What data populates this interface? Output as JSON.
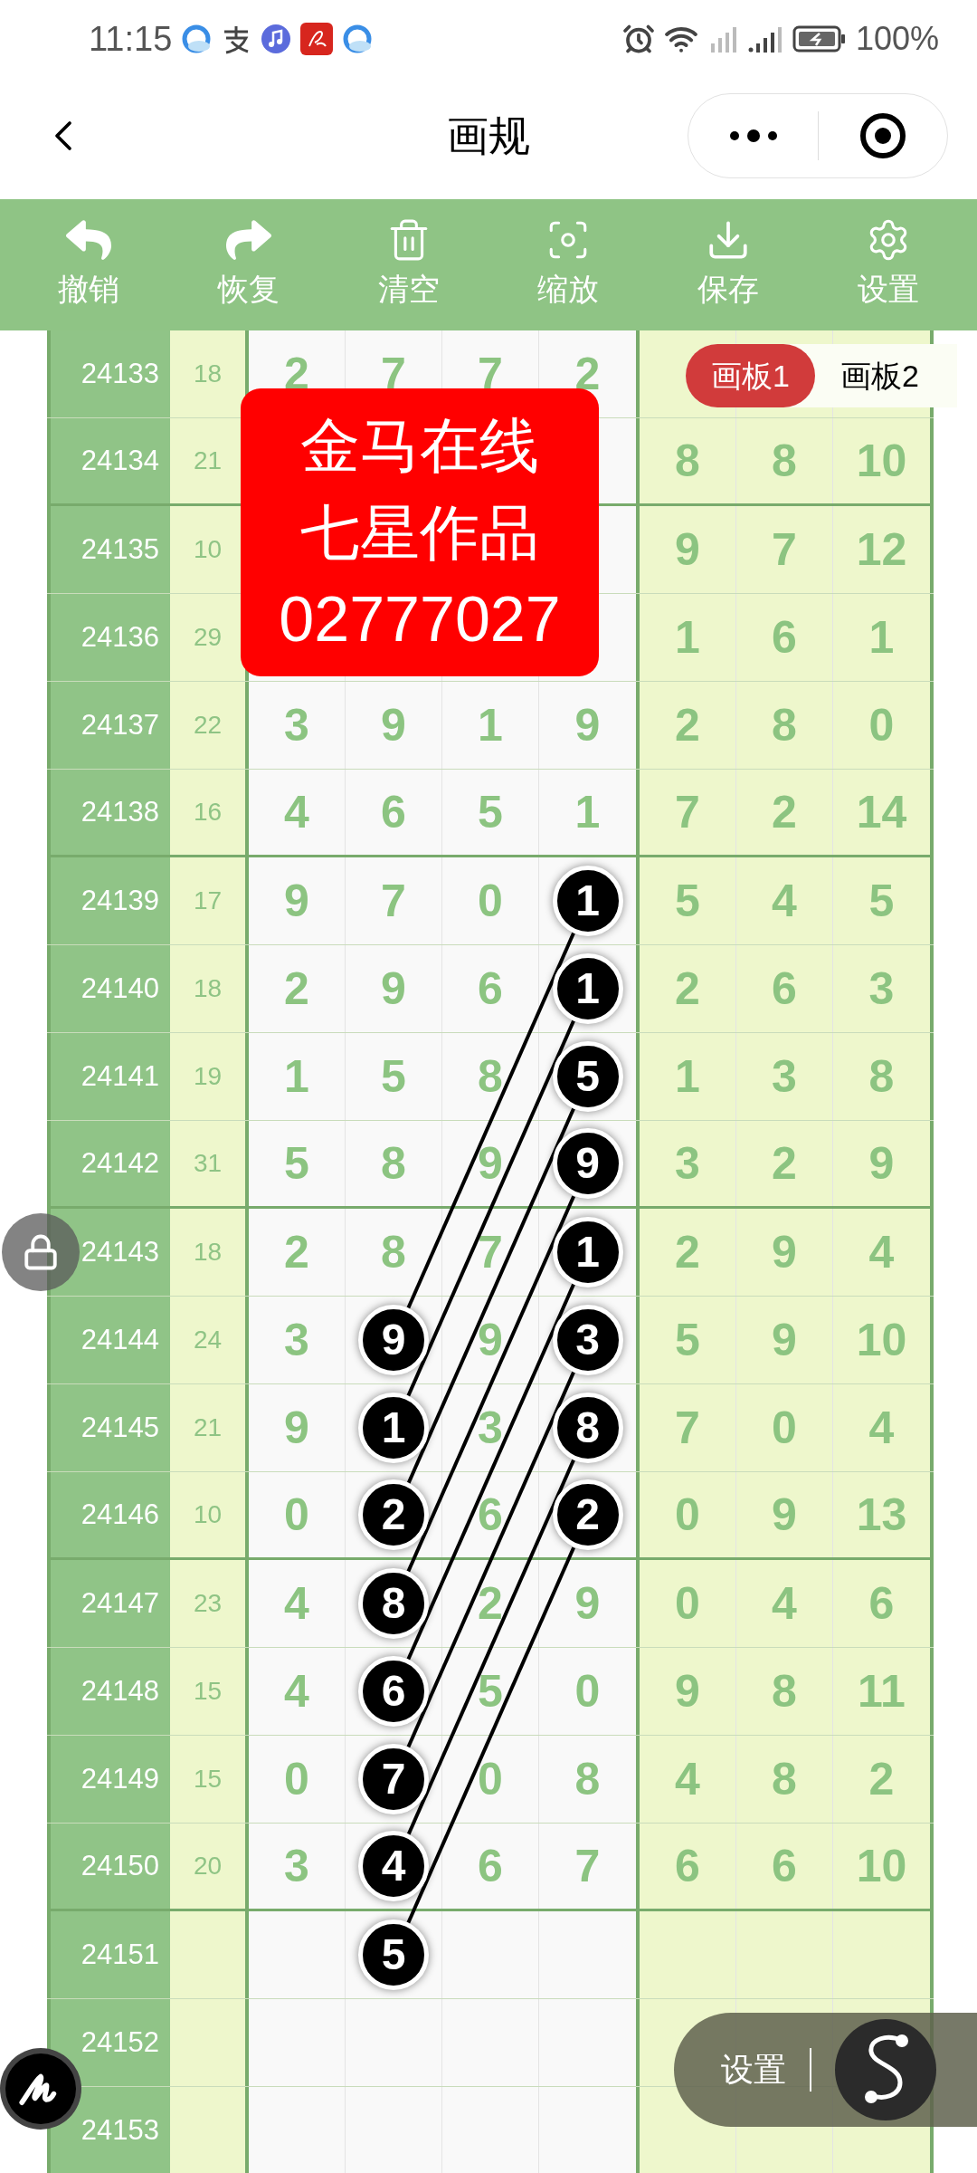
{
  "status_bar": {
    "time": "11:15",
    "battery": "100%"
  },
  "nav": {
    "title": "画规"
  },
  "toolbar": [
    {
      "kind": "undo",
      "label": "撤销"
    },
    {
      "kind": "redo",
      "label": "恢复"
    },
    {
      "kind": "clear",
      "label": "清空"
    },
    {
      "kind": "zoom",
      "label": "缩放"
    },
    {
      "kind": "save",
      "label": "保存"
    },
    {
      "kind": "settings",
      "label": "设置"
    }
  ],
  "board_tabs": [
    {
      "label": "画板1",
      "selected": true
    },
    {
      "label": "画板2",
      "selected": false
    }
  ],
  "banner": {
    "lines": [
      "金马在线",
      "七星作品",
      "02777027"
    ]
  },
  "rows": [
    {
      "issue": "24133",
      "sum": "18",
      "cells": [
        "2",
        "7",
        "7",
        "2",
        null,
        null,
        null
      ]
    },
    {
      "issue": "24134",
      "sum": "21",
      "cells": [
        null,
        null,
        null,
        null,
        "8",
        "8",
        "10"
      ]
    },
    {
      "issue": "24135",
      "sum": "10",
      "cells": [
        null,
        null,
        null,
        null,
        "9",
        "7",
        "12"
      ]
    },
    {
      "issue": "24136",
      "sum": "29",
      "cells": [
        null,
        null,
        null,
        null,
        "1",
        "6",
        "1"
      ]
    },
    {
      "issue": "24137",
      "sum": "22",
      "cells": [
        "3",
        "9",
        "1",
        "9",
        "2",
        "8",
        "0"
      ]
    },
    {
      "issue": "24138",
      "sum": "16",
      "cells": [
        "4",
        "6",
        "5",
        "1",
        "7",
        "2",
        "14"
      ]
    },
    {
      "issue": "24139",
      "sum": "17",
      "cells": [
        "9",
        "7",
        "0",
        {
          "value": "1",
          "circled": true
        },
        "5",
        "4",
        "5"
      ]
    },
    {
      "issue": "24140",
      "sum": "18",
      "cells": [
        "2",
        "9",
        "6",
        {
          "value": "1",
          "circled": true
        },
        "2",
        "6",
        "3"
      ]
    },
    {
      "issue": "24141",
      "sum": "19",
      "cells": [
        "1",
        "5",
        "8",
        {
          "value": "5",
          "circled": true
        },
        "1",
        "3",
        "8"
      ]
    },
    {
      "issue": "24142",
      "sum": "31",
      "cells": [
        "5",
        "8",
        "9",
        {
          "value": "9",
          "circled": true
        },
        "3",
        "2",
        "9"
      ]
    },
    {
      "issue": "24143",
      "sum": "18",
      "cells": [
        "2",
        "8",
        "7",
        {
          "value": "1",
          "circled": true
        },
        "2",
        "9",
        "4"
      ]
    },
    {
      "issue": "24144",
      "sum": "24",
      "cells": [
        "3",
        {
          "value": "9",
          "circled": true
        },
        "9",
        {
          "value": "3",
          "circled": true
        },
        "5",
        "9",
        "10"
      ]
    },
    {
      "issue": "24145",
      "sum": "21",
      "cells": [
        "9",
        {
          "value": "1",
          "circled": true
        },
        "3",
        {
          "value": "8",
          "circled": true
        },
        "7",
        "0",
        "4"
      ]
    },
    {
      "issue": "24146",
      "sum": "10",
      "cells": [
        "0",
        {
          "value": "2",
          "circled": true
        },
        "6",
        {
          "value": "2",
          "circled": true
        },
        "0",
        "9",
        "13"
      ]
    },
    {
      "issue": "24147",
      "sum": "23",
      "cells": [
        "4",
        {
          "value": "8",
          "circled": true
        },
        "2",
        "9",
        "0",
        "4",
        "6"
      ]
    },
    {
      "issue": "24148",
      "sum": "15",
      "cells": [
        "4",
        {
          "value": "6",
          "circled": true
        },
        "5",
        "0",
        "9",
        "8",
        "11"
      ]
    },
    {
      "issue": "24149",
      "sum": "15",
      "cells": [
        "0",
        {
          "value": "7",
          "circled": true
        },
        "0",
        "8",
        "4",
        "8",
        "2"
      ]
    },
    {
      "issue": "24150",
      "sum": "20",
      "cells": [
        "3",
        {
          "value": "4",
          "circled": true
        },
        "6",
        "7",
        "6",
        "6",
        "10"
      ]
    },
    {
      "issue": "24151",
      "sum": null,
      "cells": [
        null,
        {
          "value": "5",
          "circled": true
        },
        null,
        null,
        null,
        null,
        null
      ]
    },
    {
      "issue": "24152",
      "sum": null,
      "cells": [
        null,
        null,
        null,
        null,
        null,
        null,
        null
      ]
    },
    {
      "issue": "24153",
      "sum": null,
      "cells": [
        null,
        null,
        null,
        null,
        null,
        null,
        null
      ]
    }
  ],
  "floating": {
    "settings_label": "设置"
  }
}
